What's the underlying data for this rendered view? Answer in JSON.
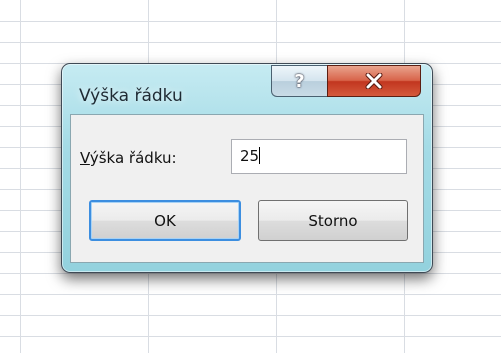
{
  "dialog": {
    "title": "Výška řádku",
    "help_glyph": "?",
    "field_label_prefix": "V",
    "field_label_rest": "ýška řádku:",
    "field_value": "25",
    "ok_label": "OK",
    "cancel_label": "Storno"
  },
  "icons": {
    "help": "question-mark-icon",
    "close": "close-x-icon"
  },
  "colors": {
    "frame": "#a4dbe6",
    "close_button": "#c2361f",
    "default_button_border": "#3c8ee0"
  }
}
